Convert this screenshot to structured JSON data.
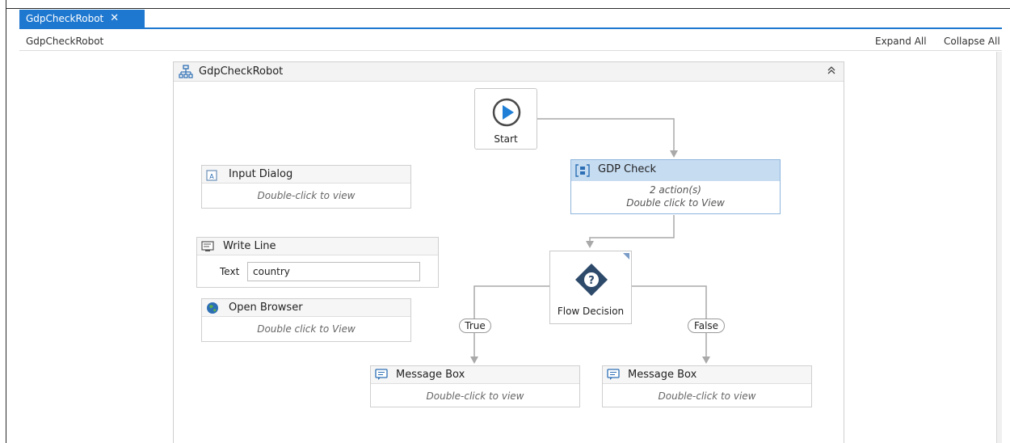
{
  "tab": {
    "title": "GdpCheckRobot",
    "close": "✕"
  },
  "breadcrumb": "GdpCheckRobot",
  "toolbar": {
    "expand_all": "Expand All",
    "collapse_all": "Collapse All"
  },
  "flowchart": {
    "title": "GdpCheckRobot",
    "collapse_icon": "double-chevron-up-icon",
    "start": {
      "label": "Start"
    },
    "gdp_check": {
      "title": "GDP Check",
      "actions": "2 action(s)",
      "hint": "Double click to View"
    },
    "decision": {
      "label": "Flow Decision",
      "true_label": "True",
      "false_label": "False"
    },
    "input_dialog": {
      "title": "Input Dialog",
      "hint": "Double-click to view"
    },
    "write_line": {
      "title": "Write Line",
      "text_label": "Text",
      "text_value": "country"
    },
    "open_browser": {
      "title": "Open Browser",
      "hint": "Double click to View"
    },
    "message_box_true": {
      "title": "Message Box",
      "hint": "Double-click to view"
    },
    "message_box_false": {
      "title": "Message Box",
      "hint": "Double-click to view"
    }
  },
  "colors": {
    "accent": "#1f78d0",
    "sequence_header": "#c6dcf1",
    "start_play": "#1f7fd6",
    "decision": "#2e4a6b",
    "connector": "#a9a9a9"
  }
}
